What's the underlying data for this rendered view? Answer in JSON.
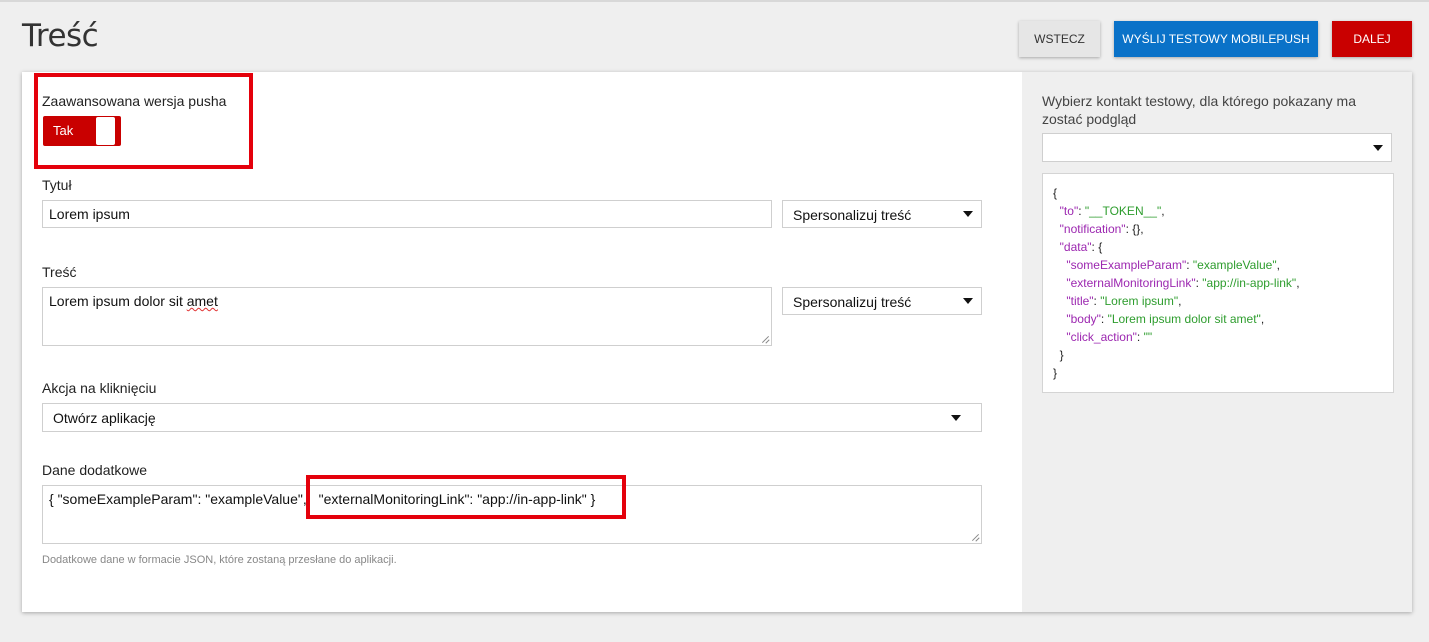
{
  "page": {
    "title": "Treść"
  },
  "toolbar": {
    "back_label": "WSTECZ",
    "test_label": "WYŚLIJ TESTOWY MOBILEPUSH",
    "next_label": "DALEJ"
  },
  "form": {
    "advanced": {
      "label": "Zaawansowana wersja pusha",
      "toggle_text": "Tak",
      "on": true
    },
    "title_field": {
      "label": "Tytuł",
      "value": "Lorem ipsum",
      "personalize": "Spersonalizuj treść"
    },
    "body_field": {
      "label": "Treść",
      "value_a": "Lorem ipsum dolor sit ",
      "value_b": "amet",
      "personalize": "Spersonalizuj treść"
    },
    "action": {
      "label": "Akcja na kliknięciu",
      "value": "Otwórz aplikację"
    },
    "extra": {
      "label": "Dane dodatkowe",
      "value_a": "{ \"someExampleParam\": \"exampleValue\",",
      "value_b": "\"externalMonitoringLink\": \"app://in-app-link\" }",
      "hint": "Dodatkowe dane w formacie JSON, które zostaną przesłane do aplikacji."
    }
  },
  "preview": {
    "label": "Wybierz kontakt testowy, dla którego pokazany ma zostać podgląd",
    "contact_value": "",
    "json": {
      "open": "{",
      "to_key": "\"to\"",
      "to_val": "\"__TOKEN__\"",
      "notification_key": "\"notification\"",
      "notification_val": "{},",
      "data_key": "\"data\"",
      "data_open": ": {",
      "p1_key": "\"someExampleParam\"",
      "p1_val": "\"exampleValue\"",
      "p2_key": "\"externalMonitoringLink\"",
      "p2_val": "\"app://in-app-link\"",
      "p3_key": "\"title\"",
      "p3_val": "\"Lorem ipsum\"",
      "p4_key": "\"body\"",
      "p4_val": "\"Lorem ipsum dolor sit amet\"",
      "p5_key": "\"click_action\"",
      "p5_val": "\"\"",
      "inner_close": "}",
      "close": "}"
    }
  },
  "colors": {
    "accent_red": "#c90000",
    "primary_blue": "#0a72c8",
    "highlight_red": "#e4000b",
    "json_key": "#9c27b0",
    "json_value": "#2e9d2e"
  }
}
